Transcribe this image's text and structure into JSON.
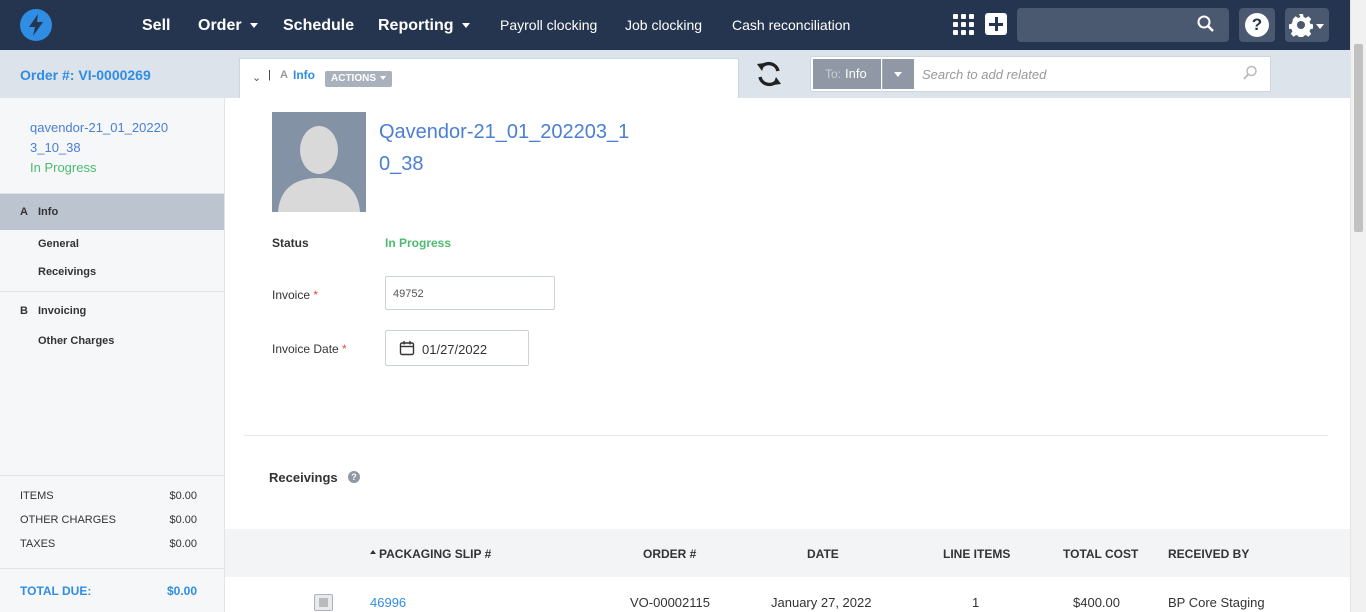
{
  "topnav": {
    "logo": "bolt-logo-icon",
    "items": [
      {
        "label": "Sell"
      },
      {
        "label": "Order"
      },
      {
        "label": "Schedule"
      },
      {
        "label": "Reporting"
      },
      {
        "label": "Payroll clocking"
      },
      {
        "label": "Job clocking"
      },
      {
        "label": "Cash reconciliation"
      }
    ],
    "search_placeholder": "",
    "help_label": "?"
  },
  "sidebar": {
    "order_title": "Order #: VI-0000269",
    "vendor_name": "qavendor-21_01_202203_10_38",
    "status": "In Progress",
    "sections": [
      {
        "letter": "A",
        "label": "Info",
        "items": [
          "General",
          "Receivings"
        ]
      },
      {
        "letter": "B",
        "label": "Invoicing",
        "items": [
          "Other Charges"
        ]
      }
    ],
    "totals": [
      {
        "label": "ITEMS",
        "value": "$0.00"
      },
      {
        "label": "OTHER CHARGES",
        "value": "$0.00"
      },
      {
        "label": "TAXES",
        "value": "$0.00"
      }
    ],
    "total_due_label": "TOTAL DUE:",
    "total_due_value": "$0.00"
  },
  "tabbar": {
    "tab_letter": "A",
    "tab_label": "Info",
    "actions_label": "ACTIONS",
    "related_to_prefix": "To:",
    "related_to_value": "Info",
    "related_search_placeholder": "Search to add related"
  },
  "main": {
    "vendor_title": "Qavendor-21_01_202203_10_38",
    "status_label": "Status",
    "status_value": "In Progress",
    "invoice_label": "Invoice",
    "invoice_value": "49752",
    "invoice_date_label": "Invoice Date",
    "invoice_date_value": "01/27/2022",
    "receivings_title": "Receivings",
    "help_mark": "?"
  },
  "table": {
    "columns": [
      "PACKAGING SLIP #",
      "ORDER #",
      "DATE",
      "LINE ITEMS",
      "TOTAL COST",
      "RECEIVED BY"
    ],
    "rows": [
      {
        "packaging_slip": "46996",
        "order": "VO-00002115",
        "date": "January 27, 2022",
        "line_items": "1",
        "total_cost": "$400.00",
        "received_by": "BP Core Staging"
      }
    ]
  },
  "colors": {
    "nav_bg": "#26354f",
    "accent": "#2f8de4",
    "status_green": "#4cbb6e",
    "required": "#e74c3c"
  }
}
